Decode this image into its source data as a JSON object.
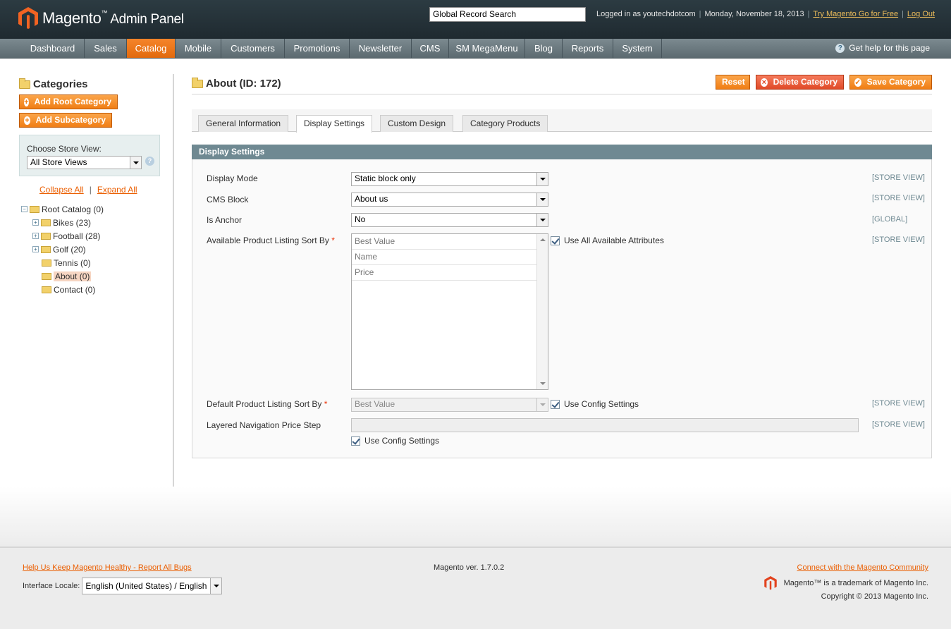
{
  "header": {
    "logo_word": "Magento",
    "logo_tm": "™",
    "logo_suffix": "Admin Panel",
    "search_value": "Global Record Search",
    "logged_in": "Logged in as youtechdotcom",
    "date": "Monday, November 18, 2013",
    "try_link": "Try Magento Go for Free",
    "logout_link": "Log Out"
  },
  "nav": {
    "items": [
      "Dashboard",
      "Sales",
      "Catalog",
      "Mobile",
      "Customers",
      "Promotions",
      "Newsletter",
      "CMS",
      "SM MegaMenu",
      "Blog",
      "Reports",
      "System"
    ],
    "active": "Catalog",
    "help": "Get help for this page"
  },
  "sidebar": {
    "title": "Categories",
    "add_root": "Add Root Category",
    "add_sub": "Add Subcategory",
    "store_label": "Choose Store View:",
    "store_value": "All Store Views",
    "collapse": "Collapse All",
    "expand": "Expand All",
    "tree": [
      {
        "label": "Root Catalog (0)"
      },
      {
        "label": "Bikes (23)"
      },
      {
        "label": "Football (28)"
      },
      {
        "label": "Golf (20)"
      },
      {
        "label": "Tennis (0)"
      },
      {
        "label": "About (0)"
      },
      {
        "label": "Contact (0)"
      }
    ]
  },
  "main": {
    "title": "About (ID: 172)",
    "reset": "Reset",
    "delete": "Delete Category",
    "save": "Save Category",
    "tabs": [
      "General Information",
      "Display Settings",
      "Custom Design",
      "Category Products"
    ],
    "active_tab": "Display Settings",
    "section_title": "Display Settings",
    "fields": {
      "display_mode": {
        "label": "Display Mode",
        "value": "Static block only",
        "scope": "[STORE VIEW]"
      },
      "cms_block": {
        "label": "CMS Block",
        "value": "About us",
        "scope": "[STORE VIEW]"
      },
      "is_anchor": {
        "label": "Is Anchor",
        "value": "No",
        "scope": "[GLOBAL]"
      },
      "available_sort": {
        "label": "Available Product Listing Sort By",
        "options": [
          "Best Value",
          "Name",
          "Price"
        ],
        "checkbox": "Use All Available Attributes",
        "scope": "[STORE VIEW]"
      },
      "default_sort": {
        "label": "Default Product Listing Sort By",
        "value": "Best Value",
        "checkbox": "Use Config Settings",
        "scope": "[STORE VIEW]"
      },
      "price_step": {
        "label": "Layered Navigation Price Step",
        "checkbox": "Use Config Settings",
        "scope": "[STORE VIEW]"
      }
    },
    "required_mark": "*"
  },
  "footer": {
    "bugs_link": "Help Us Keep Magento Healthy - Report All Bugs",
    "locale_label": "Interface Locale:",
    "locale_value": "English (United States) / English",
    "version": "Magento ver. 1.7.0.2",
    "community_link": "Connect with the Magento Community",
    "trademark": "Magento™ is a trademark of Magento Inc.",
    "copyright": "Copyright © 2013 Magento Inc."
  },
  "colors": {
    "accent": "#f07e15",
    "header_bg": "#2c3b42",
    "section_head": "#6f8992",
    "link": "#eb5e00"
  }
}
